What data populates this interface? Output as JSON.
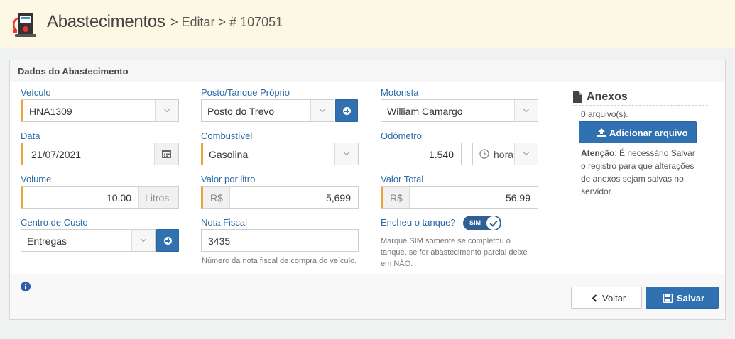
{
  "header": {
    "title": "Abastecimentos",
    "breadcrumb": "> Editar > # 107051"
  },
  "panel": {
    "title": "Dados do Abastecimento"
  },
  "form": {
    "veiculo": {
      "label": "Veículo",
      "value": "HNA1309"
    },
    "posto": {
      "label": "Posto/Tanque Próprio",
      "value": "Posto do Trevo"
    },
    "motorista": {
      "label": "Motorista",
      "value": "William Camargo"
    },
    "data": {
      "label": "Data",
      "value": "21/07/2021"
    },
    "combustivel": {
      "label": "Combustível",
      "value": "Gasolina"
    },
    "odometro": {
      "label": "Odômetro",
      "value": "1.540",
      "hora_value": "hora"
    },
    "volume": {
      "label": "Volume",
      "value": "10,00",
      "unit": "Litros"
    },
    "valor_litro": {
      "label": "Valor por litro",
      "currency": "R$",
      "value": "5,699"
    },
    "valor_total": {
      "label": "Valor Total",
      "currency": "R$",
      "value": "56,99"
    },
    "centro_custo": {
      "label": "Centro de Custo",
      "value": "Entregas"
    },
    "nota_fiscal": {
      "label": "Nota Fiscal",
      "value": "3435",
      "help": "Número da nota fiscal de compra do veículo."
    },
    "encheu": {
      "label": "Encheu o tanque?",
      "toggle_label": "SIM",
      "checked": true,
      "help_lines": [
        "Marque SIM somente se completou o",
        "tanque, se for abastecimento parcial deixe",
        "em NÃO."
      ]
    }
  },
  "anexos": {
    "title": "Anexos",
    "count": "0 arquivo(s).",
    "add_button": "Adicionar arquivo",
    "note_bold": "Atenção",
    "note_lines": [
      ": É necessário Salvar",
      "o registro para que alterações",
      "de anexos sejam salvas no",
      "servidor."
    ]
  },
  "footer": {
    "back_button": "Voltar",
    "save_button": "Salvar"
  },
  "colors": {
    "primary": "#2f71b1",
    "required_marker": "#f0a23a",
    "label": "#2a6aa8",
    "header_bg": "#fdf8e3"
  },
  "icons": [
    "fuel-pump-logo-icon",
    "calendar-icon",
    "clock-icon",
    "plus-circle-icon",
    "file-icon",
    "upload-icon",
    "info-icon",
    "chevron-left-icon",
    "save-icon",
    "check-icon",
    "chevron-down-icon"
  ]
}
